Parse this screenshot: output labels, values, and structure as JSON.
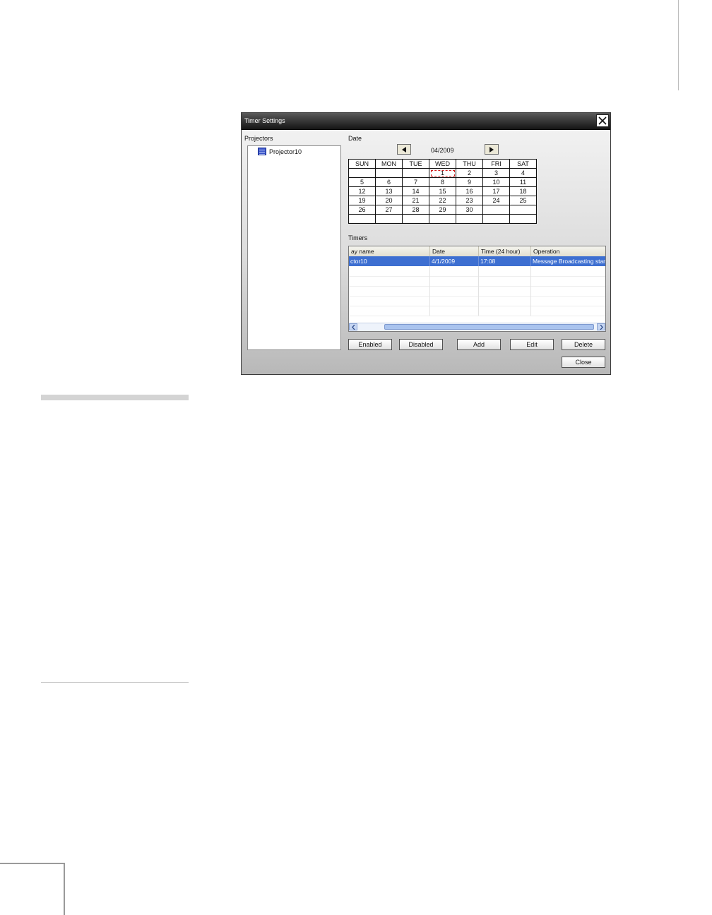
{
  "dialog": {
    "title": "Timer Settings",
    "projectors_label": "Projectors",
    "projectors": [
      {
        "name": "Projector10"
      }
    ],
    "date_label": "Date",
    "month": "04/2009",
    "weekdays": [
      "SUN",
      "MON",
      "TUE",
      "WED",
      "THU",
      "FRI",
      "SAT"
    ],
    "weeks": [
      [
        "",
        "",
        "",
        "1",
        "2",
        "3",
        "4"
      ],
      [
        "5",
        "6",
        "7",
        "8",
        "9",
        "10",
        "11"
      ],
      [
        "12",
        "13",
        "14",
        "15",
        "16",
        "17",
        "18"
      ],
      [
        "19",
        "20",
        "21",
        "22",
        "23",
        "24",
        "25"
      ],
      [
        "26",
        "27",
        "28",
        "29",
        "30",
        "",
        ""
      ],
      [
        "",
        "",
        "",
        "",
        "",
        "",
        ""
      ]
    ],
    "selected_day": "1",
    "timers_label": "Timers",
    "timer_columns": [
      "ay name",
      "Date",
      "Time (24 hour)",
      "Operation"
    ],
    "timer_rows": [
      [
        "ctor10",
        "4/1/2009",
        "17:08",
        "Message Broadcasting start"
      ]
    ],
    "buttons": {
      "enabled": "Enabled",
      "disabled": "Disabled",
      "add": "Add",
      "edit": "Edit",
      "delete": "Delete",
      "close": "Close"
    }
  },
  "icons": {
    "close": "close-icon",
    "prev": "triangle-left-icon",
    "next": "triangle-right-icon",
    "projector": "projector-icon"
  }
}
